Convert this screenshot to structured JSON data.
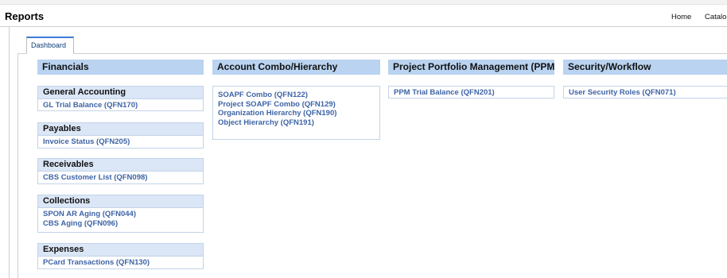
{
  "header": {
    "title": "Reports",
    "nav": [
      "Home",
      "Catalog"
    ]
  },
  "tabs": [
    {
      "label": "Dashboard"
    }
  ],
  "columns": {
    "financials": {
      "title": "Financials",
      "sections": {
        "general_accounting": {
          "title": "General Accounting",
          "links": [
            "GL Trial Balance (QFN170)"
          ]
        },
        "payables": {
          "title": "Payables",
          "links": [
            "Invoice Status (QFN205)"
          ]
        },
        "receivables": {
          "title": "Receivables",
          "links": [
            "CBS Customer List (QFN098)"
          ]
        },
        "collections": {
          "title": "Collections",
          "links": [
            "SPON AR Aging (QFN044)",
            "CBS Aging (QFN096)"
          ]
        },
        "expenses": {
          "title": "Expenses",
          "links": [
            "PCard Transactions (QFN130)"
          ]
        }
      }
    },
    "account_combo": {
      "title": "Account Combo/Hierarchy",
      "links": [
        "SOAPF Combo (QFN122)",
        "Project SOAPF Combo (QFN129)",
        "Organization Hierarchy (QFN190)",
        "Object Hierarchy (QFN191)"
      ]
    },
    "ppm": {
      "title": "Project Portfolio Management (PPM)",
      "links": [
        "PPM Trial Balance (QFN201)"
      ]
    },
    "security": {
      "title": "Security/Workflow",
      "links": [
        "User Security Roles (QFN071)"
      ]
    }
  },
  "colors": {
    "header_bg": "#b9d3f0",
    "section_bg": "#dbe6f6",
    "link": "#3e64a6",
    "tab_accent": "#3a7bd5"
  }
}
